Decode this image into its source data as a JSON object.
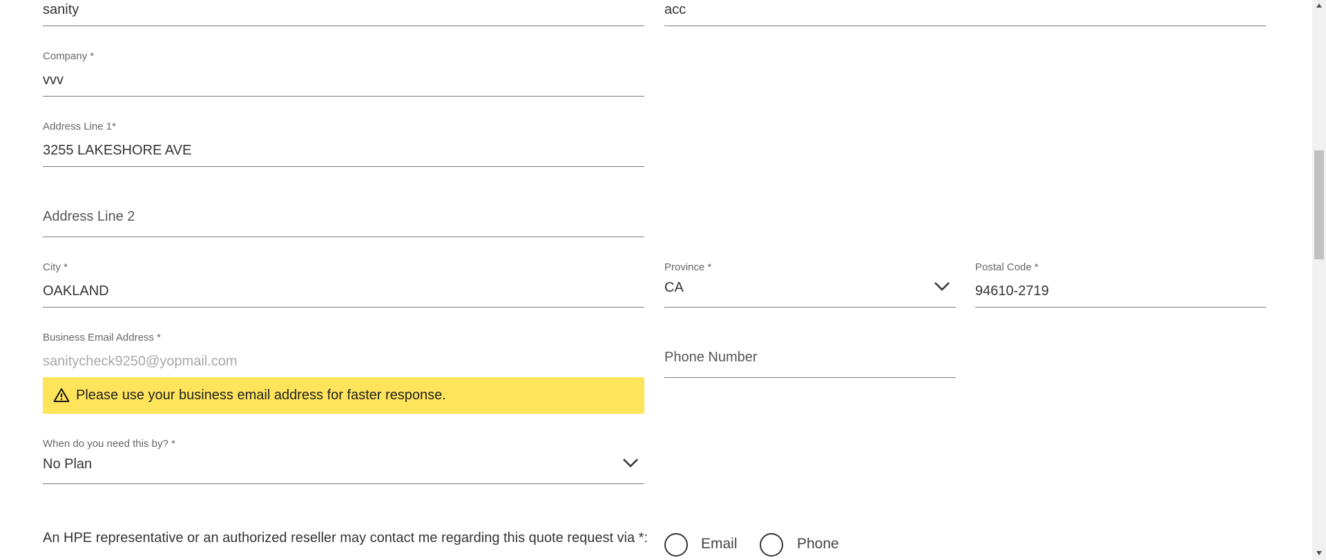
{
  "form": {
    "first_name": {
      "value": "sanity"
    },
    "last_name": {
      "value": "acc"
    },
    "company": {
      "label": "Company *",
      "value": "vvv"
    },
    "address1": {
      "label": "Address Line 1*",
      "value": "3255 LAKESHORE AVE"
    },
    "address2": {
      "placeholder": "Address Line 2"
    },
    "city": {
      "label": "City *",
      "value": "OAKLAND"
    },
    "province": {
      "label": "Province *",
      "value": "CA"
    },
    "postal_code": {
      "label": "Postal Code *",
      "value": "94610-2719"
    },
    "email": {
      "label": "Business Email Address *",
      "value": "sanitycheck9250@yopmail.com"
    },
    "phone": {
      "placeholder": "Phone Number"
    },
    "warning": {
      "icon": "warning-triangle-icon",
      "text": "Please use your business email address for faster response.",
      "color": "#fee45a"
    },
    "timeline": {
      "label": "When do you need this by? *",
      "value": "No Plan"
    },
    "contact": {
      "question": "An HPE representative or an authorized reseller may contact me regarding this quote request via *:",
      "options": [
        {
          "label": "Email",
          "selected": false
        },
        {
          "label": "Phone",
          "selected": false
        }
      ]
    }
  }
}
